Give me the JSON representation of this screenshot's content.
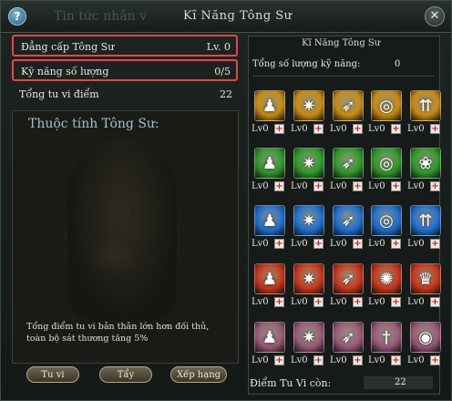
{
  "window": {
    "title": "Kĩ Năng Tông Sư",
    "background_tab_title": "Tin tức nhân v",
    "help_glyph": "?",
    "close_glyph": "✕"
  },
  "stats": [
    {
      "label": "Đẳng cấp Tông Sư",
      "value": "Lv. 0"
    },
    {
      "label": "Kỹ năng số lượng",
      "value": "0/5"
    },
    {
      "label": "Tổng tu vi điểm",
      "value": "22"
    }
  ],
  "attributes": {
    "title": "Thuộc tính Tông Sư:",
    "description": "Tổng điểm tu vi bản thân lớn hơn đối thủ, toàn bộ sát thương tăng 5%"
  },
  "buttons": [
    {
      "label": "Tu vi"
    },
    {
      "label": "Tẩy"
    },
    {
      "label": "Xếp hạng"
    }
  ],
  "skills_panel": {
    "title": "Kĩ Năng Tông Sư",
    "total_label": "Tổng số lượng kỹ năng:",
    "total_value": "0",
    "points_label": "Điểm Tu Vi còn:",
    "points_value": "22",
    "plus_glyph": "+",
    "rows": [
      {
        "theme": "fire-gold",
        "color": "#c98a12",
        "skills": [
          {
            "level": "Lv0",
            "icon": "flame-figure-icon",
            "glyph": "♟"
          },
          {
            "level": "Lv0",
            "icon": "burst-strike-icon",
            "glyph": "✷"
          },
          {
            "level": "Lv0",
            "icon": "arrow-volley-icon",
            "glyph": "➶"
          },
          {
            "level": "Lv0",
            "icon": "vortex-icon",
            "glyph": "◎"
          },
          {
            "level": "Lv0",
            "icon": "triple-arrow-icon",
            "glyph": "⇈"
          }
        ]
      },
      {
        "theme": "nature-green",
        "color": "#2f9a2a",
        "skills": [
          {
            "level": "Lv0",
            "icon": "aura-figure-icon",
            "glyph": "♟"
          },
          {
            "level": "Lv0",
            "icon": "leaf-strike-icon",
            "glyph": "✷"
          },
          {
            "level": "Lv0",
            "icon": "wind-arrow-icon",
            "glyph": "➶"
          },
          {
            "level": "Lv0",
            "icon": "orbit-icon",
            "glyph": "◎"
          },
          {
            "level": "Lv0",
            "icon": "lotus-icon",
            "glyph": "❀"
          }
        ]
      },
      {
        "theme": "ice-blue",
        "color": "#1f6fd0",
        "skills": [
          {
            "level": "Lv0",
            "icon": "frost-figure-icon",
            "glyph": "♟"
          },
          {
            "level": "Lv0",
            "icon": "ice-strike-icon",
            "glyph": "✷"
          },
          {
            "level": "Lv0",
            "icon": "frost-arrow-icon",
            "glyph": "➶"
          },
          {
            "level": "Lv0",
            "icon": "whirlwind-icon",
            "glyph": "◎"
          },
          {
            "level": "Lv0",
            "icon": "ice-shard-icon",
            "glyph": "⇈"
          }
        ]
      },
      {
        "theme": "blaze-red",
        "color": "#c8361a",
        "skills": [
          {
            "level": "Lv0",
            "icon": "blaze-figure-icon",
            "glyph": "♟"
          },
          {
            "level": "Lv0",
            "icon": "ember-strike-icon",
            "glyph": "✷"
          },
          {
            "level": "Lv0",
            "icon": "fire-arrow-icon",
            "glyph": "➶"
          },
          {
            "level": "Lv0",
            "icon": "explosion-icon",
            "glyph": "✺"
          },
          {
            "level": "Lv0",
            "icon": "flame-crown-icon",
            "glyph": "♛"
          }
        ]
      },
      {
        "theme": "spirit-pink",
        "color": "#9a5a78",
        "skills": [
          {
            "level": "Lv0",
            "icon": "spirit-figure-icon",
            "glyph": "♟"
          },
          {
            "level": "Lv0",
            "icon": "mist-strike-icon",
            "glyph": "✷"
          },
          {
            "level": "Lv0",
            "icon": "soul-arrow-icon",
            "glyph": "➶"
          },
          {
            "level": "Lv0",
            "icon": "spirit-blade-icon",
            "glyph": "†"
          },
          {
            "level": "Lv0",
            "icon": "ring-guardian-icon",
            "glyph": "◉"
          }
        ]
      }
    ]
  }
}
